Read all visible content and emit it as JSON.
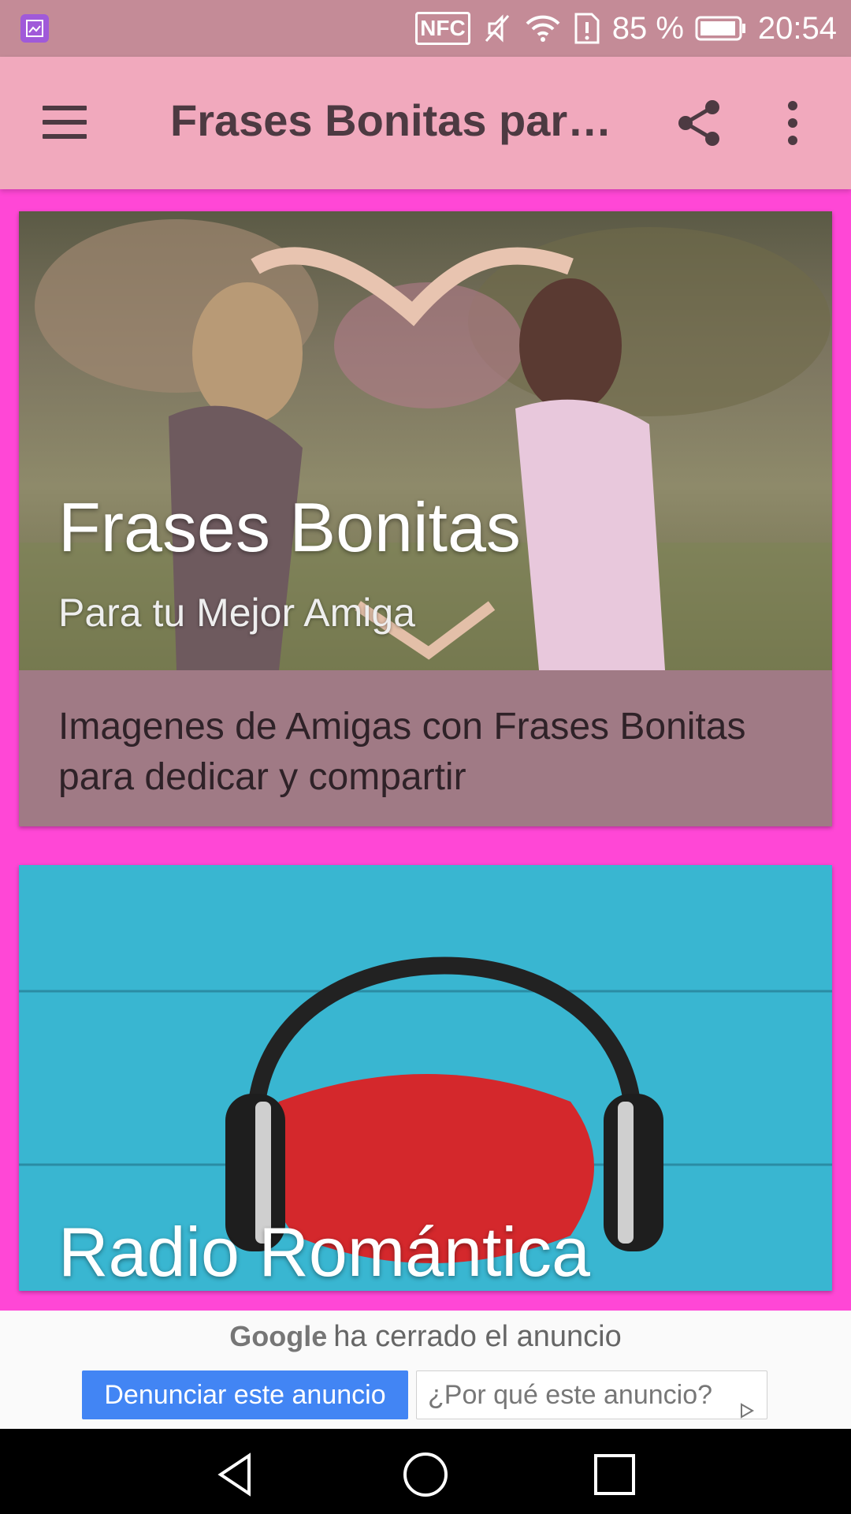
{
  "status_bar": {
    "nfc": "NFC",
    "battery_percent": "85 %",
    "time": "20:54",
    "icons": [
      "gallery-icon",
      "nfc-icon",
      "mute-icon",
      "wifi-icon",
      "sim-alert-icon",
      "battery-icon"
    ]
  },
  "app_bar": {
    "title": "Frases Bonitas para…",
    "icons": [
      "menu-icon",
      "share-icon",
      "more-vert-icon"
    ],
    "background": "#f1a9bd"
  },
  "cards": [
    {
      "title": "Frases Bonitas",
      "subtitle": "Para tu Mejor Amiga",
      "description": "Imagenes de Amigas con Frases Bonitas para dedicar y compartir"
    },
    {
      "title": "Radio Romántica"
    }
  ],
  "ad": {
    "brand": "Google",
    "closed_text": "ha cerrado el anuncio",
    "report_label": "Denunciar este anuncio",
    "why_label": "¿Por qué este anuncio?"
  },
  "nav_bar": {
    "icons": [
      "back-icon",
      "home-icon",
      "recents-icon"
    ]
  },
  "colors": {
    "page_background": "#ff47d6",
    "status_bar": "#c48b97",
    "card_footer": "#a07a85",
    "ad_button": "#4285f4"
  }
}
